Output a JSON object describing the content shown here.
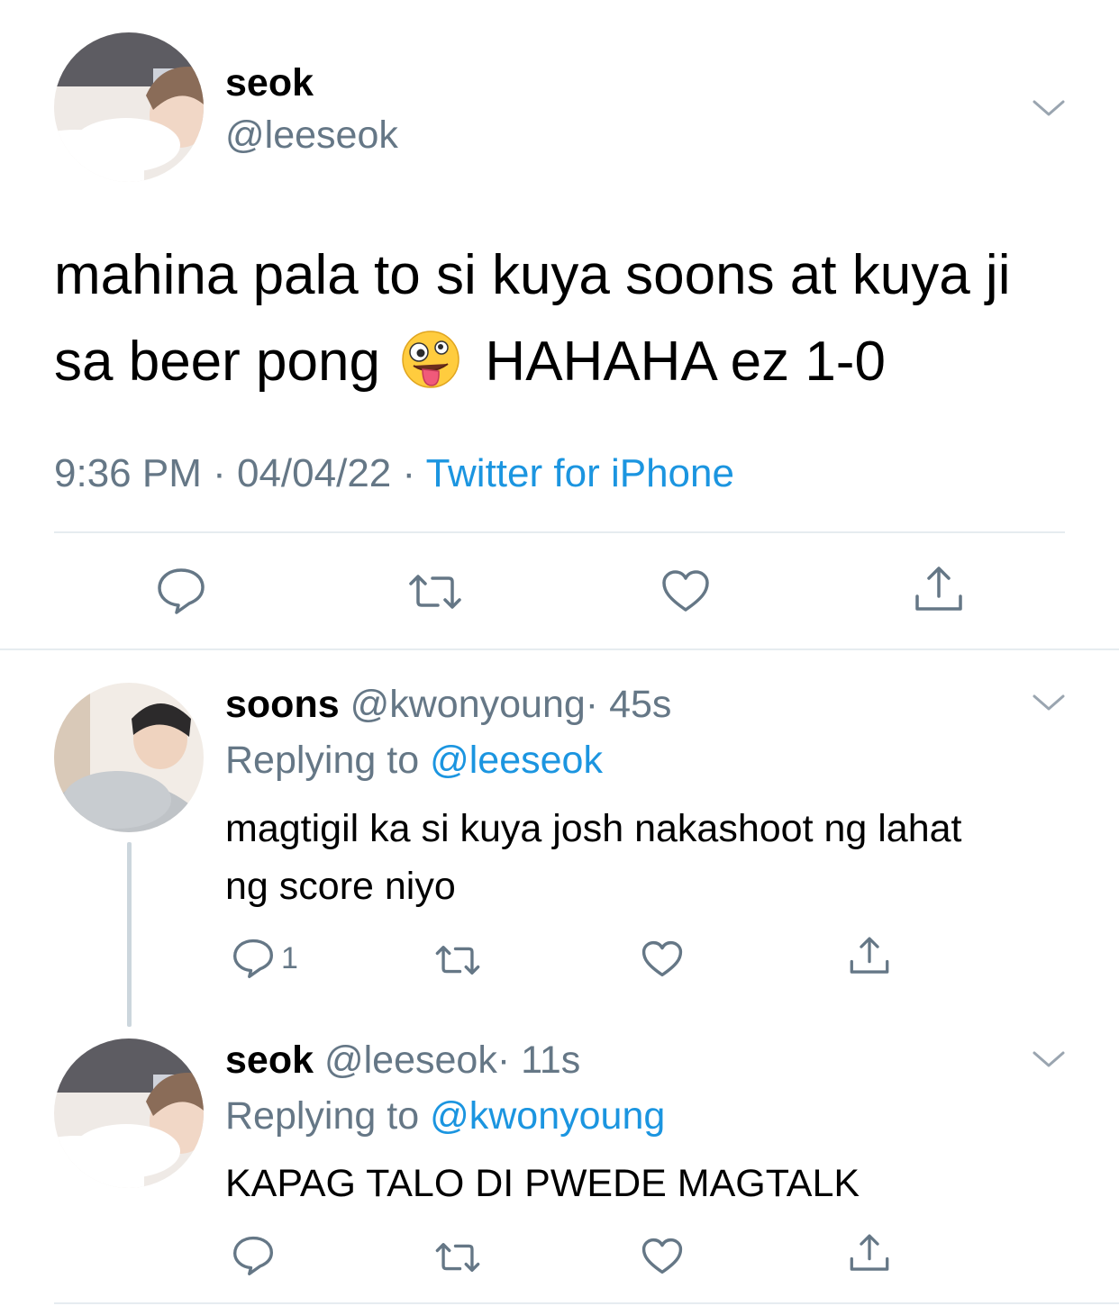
{
  "colors": {
    "accent": "#1b95e0",
    "muted": "#657786",
    "divider": "#e6ecf0",
    "text": "#000000"
  },
  "main_tweet": {
    "name": "seok",
    "handle": "@leeseok",
    "text_line1": "mahina pala to si kuya soons at kuya ji",
    "text_line2_before": "sa beer pong",
    "emoji": "zany-face",
    "text_line2_after": "HAHAHA ez 1-0",
    "time": "9:36 PM",
    "sep1": " · ",
    "date": "04/04/22",
    "sep2": " · ",
    "source": "Twitter for iPhone",
    "actions": [
      "reply-icon",
      "retweet-icon",
      "like-icon",
      "share-icon"
    ]
  },
  "replies": [
    {
      "name": "soons",
      "handle": "@kwonyoung",
      "age": "· 45s",
      "replying_label": "Replying to",
      "replying_to": "@leeseok",
      "text_line1": "magtigil ka si kuya josh nakashoot ng lahat",
      "text_line2": "ng score niyo",
      "reply_count": "1"
    },
    {
      "name": "seok",
      "handle": "@leeseok",
      "age": "· 11s",
      "replying_label": "Replying to",
      "replying_to": "@kwonyoung",
      "text_line1": "KAPAG TALO DI PWEDE MAGTALK"
    }
  ]
}
